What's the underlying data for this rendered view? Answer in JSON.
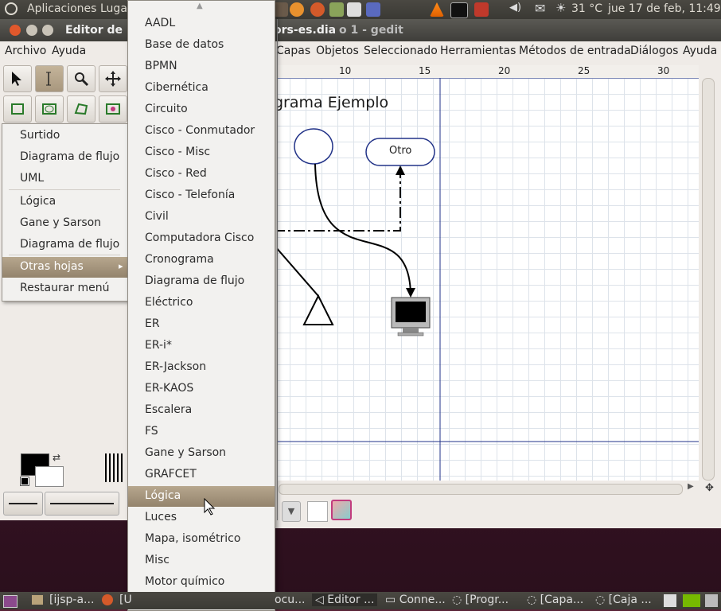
{
  "top_panel": {
    "apps": "Aplicaciones",
    "places": "Lugar",
    "temperature": "31 °C",
    "datetime": "jue 17 de feb, 11:49"
  },
  "window": {
    "title_left": "Editor de",
    "title_right": "ors-es.dia",
    "title_far": "o 1 - gedit"
  },
  "toolbox_menu": [
    "Archivo",
    "Ayuda"
  ],
  "diagram_menu": [
    "Capas",
    "Objetos",
    "Seleccionado",
    "Herramientas",
    "Métodos de entrada",
    "Diálogos",
    "Ayuda"
  ],
  "ruler": [
    "10",
    "15",
    "20",
    "25",
    "30"
  ],
  "canvas": {
    "title": "grama Ejemplo",
    "box_label": "Otro"
  },
  "sheets_menu": {
    "items": [
      "Surtido",
      "Diagrama de flujo",
      "UML",
      "Lógica",
      "Gane y Sarson",
      "Diagrama de flujo",
      "Otras hojas",
      "Restaurar menú"
    ],
    "arrow": "▸"
  },
  "submenu": {
    "items": [
      "AADL",
      "Base de datos",
      "BPMN",
      "Cibernética",
      "Circuito",
      "Cisco - Conmutador",
      "Cisco - Misc",
      "Cisco - Red",
      "Cisco - Telefonía",
      "Civil",
      "Computadora Cisco",
      "Cronograma",
      "Diagrama de flujo",
      "Eléctrico",
      "ER",
      "ER-i*",
      "ER-Jackson",
      "ER-KAOS",
      "Escalera",
      "FS",
      "Gane y Sarson",
      "GRAFCET",
      "Lógica",
      "Luces",
      "Mapa, isométrico",
      "Misc",
      "Motor químico"
    ],
    "highlighted": "Lógica",
    "scroll_up": "▲",
    "scroll_down": "▼"
  },
  "taskbar": {
    "items": [
      "[ijsp-a...",
      "[U",
      "ocu...",
      "Editor ...",
      "Conne...",
      "[Progr...",
      "[Capa...",
      "[Caja ..."
    ]
  },
  "colors": {
    "highlight": "#a8977e",
    "panel": "#3f3e3a"
  }
}
